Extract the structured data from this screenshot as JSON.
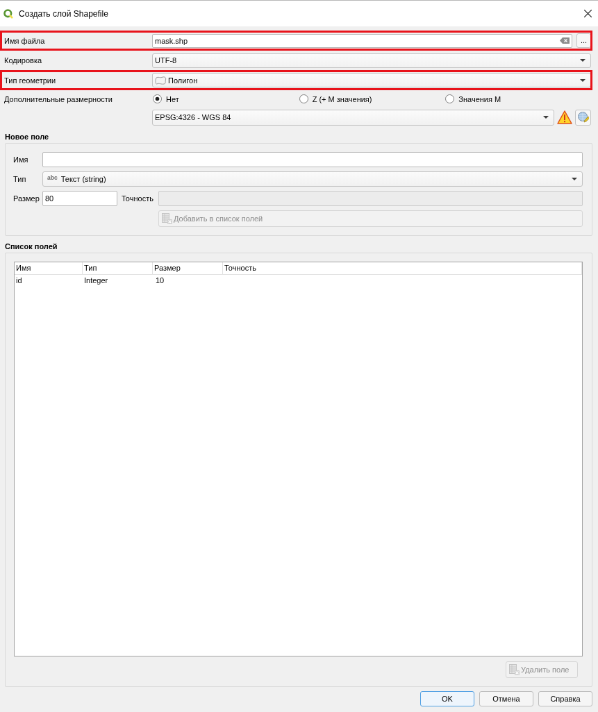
{
  "window": {
    "title": "Создать слой Shapefile"
  },
  "form": {
    "rows": [
      {
        "kind": "file",
        "label": "Имя файла",
        "value": "mask.shp",
        "browse_button": "...",
        "highlighted": true
      },
      {
        "kind": "combo",
        "label": "Кодировка",
        "value": "UTF-8",
        "highlighted": false
      },
      {
        "kind": "geometry",
        "label": "Тип геометрии",
        "value": "Полигон",
        "highlighted": true
      },
      {
        "kind": "radios",
        "label": "Дополнительные размерности",
        "options": [
          {
            "label": "Нет",
            "selected": true
          },
          {
            "label": "Z (+ M значения)",
            "selected": false
          },
          {
            "label": "Значения M",
            "selected": false
          }
        ],
        "highlighted": false
      },
      {
        "kind": "crs",
        "value": "EPSG:4326 - WGS 84",
        "highlighted": false
      }
    ]
  },
  "new_field": {
    "title": "Новое поле",
    "name_label": "Имя",
    "type_label": "Тип",
    "type_badge": "abc",
    "type_value": "Текст (string)",
    "size_label": "Размер",
    "size_value": "80",
    "precision_label": "Точность",
    "precision_disabled": true,
    "add_button": {
      "label": "Добавить в список полей",
      "disabled": true
    }
  },
  "field_list": {
    "title": "Список полей",
    "columns": [
      "Имя",
      "Тип",
      "Размер",
      "Точность"
    ],
    "rows": [
      [
        "id",
        "Integer",
        "10"
      ]
    ],
    "delete_button": {
      "label": "Удалить поле",
      "disabled": true
    }
  },
  "buttons": [
    {
      "label": "OK",
      "default": true
    },
    {
      "label": "Отмена",
      "default": false
    },
    {
      "label": "Справка",
      "default": false
    }
  ]
}
